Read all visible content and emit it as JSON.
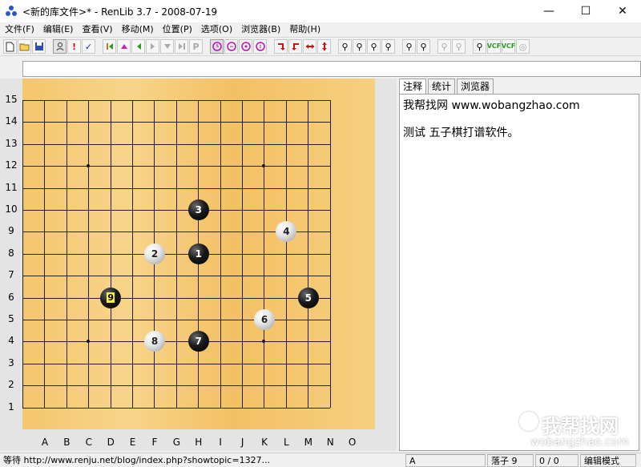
{
  "window": {
    "title": "<新的库文件>* - RenLib 3.7 - 2008-07-19",
    "controls": [
      "—",
      "☐",
      "✕"
    ]
  },
  "menu": [
    "文件(F)",
    "编辑(E)",
    "查看(V)",
    "移动(M)",
    "位置(P)",
    "选项(O)",
    "浏览器(B)",
    "帮助(H)"
  ],
  "toolbar": {
    "buttons": [
      "new",
      "open",
      "save",
      "person",
      "!",
      "✓",
      "first",
      "up",
      "back",
      "forward",
      "down",
      "last",
      "P",
      "clock",
      "G",
      "N",
      "O",
      "bend-left",
      "bend-right",
      "swap-h",
      "swap-v",
      "find-1",
      "find-2",
      "find-3",
      "find-4",
      "find-5",
      "find-6",
      "find-7",
      "find-8",
      "VCF",
      "VCF2",
      "search"
    ]
  },
  "address_value": "",
  "board": {
    "rows": [
      "15",
      "14",
      "13",
      "12",
      "11",
      "10",
      "9",
      "8",
      "7",
      "6",
      "5",
      "4",
      "3",
      "2",
      "1"
    ],
    "cols": [
      "A",
      "B",
      "C",
      "D",
      "E",
      "F",
      "G",
      "H",
      "I",
      "J",
      "K",
      "L",
      "M",
      "N",
      "O"
    ],
    "stones": [
      {
        "move": "1",
        "color": "black",
        "col": "H",
        "row": 8
      },
      {
        "move": "2",
        "color": "white",
        "col": "F",
        "row": 8
      },
      {
        "move": "3",
        "color": "black",
        "col": "H",
        "row": 10
      },
      {
        "move": "4",
        "color": "white",
        "col": "L",
        "row": 9
      },
      {
        "move": "5",
        "color": "black",
        "col": "M",
        "row": 6
      },
      {
        "move": "6",
        "color": "white",
        "col": "K",
        "row": 5
      },
      {
        "move": "7",
        "color": "black",
        "col": "H",
        "row": 4
      },
      {
        "move": "8",
        "color": "white",
        "col": "F",
        "row": 4
      },
      {
        "move": "9",
        "color": "black",
        "col": "D",
        "row": 6,
        "last": true
      }
    ]
  },
  "tabs": [
    "注释",
    "统计",
    "浏览器"
  ],
  "notes": {
    "line1": "我帮找网 www.wobangzhao.com",
    "line2": "测试 五子棋打谱软件。"
  },
  "status": {
    "message": "等待 http://www.renju.net/blog/index.php?showtopic=1327...",
    "mode_letter": "A",
    "moves": "落子 9",
    "counts": "0 / 0",
    "edit_mode": "编辑模式"
  },
  "watermark": {
    "text": "我帮找网",
    "url": "wobangzhao.com"
  }
}
